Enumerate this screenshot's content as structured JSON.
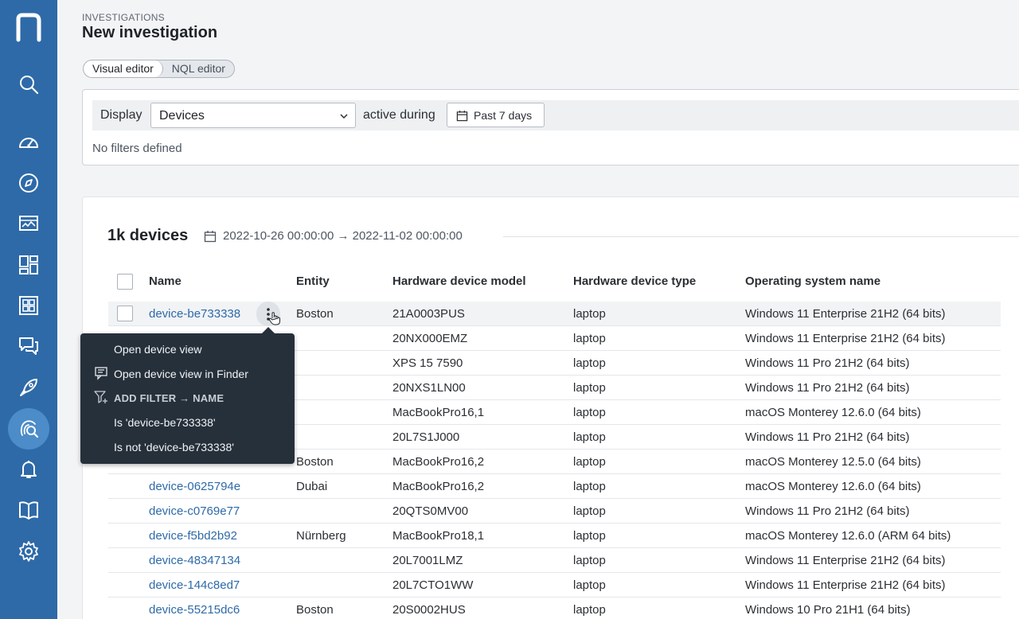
{
  "header": {
    "breadcrumb": "INVESTIGATIONS",
    "title": "New investigation"
  },
  "editor_toggle": {
    "visual": "Visual editor",
    "nql": "NQL editor",
    "active": "visual"
  },
  "builder": {
    "display_label": "Display",
    "display_value": "Devices",
    "during_label": "active during",
    "period": "Past 7 days",
    "no_filters": "No filters defined"
  },
  "results": {
    "count": "1k devices",
    "range": "2022-10-26 00:00:00 → 2022-11-02 00:00:00",
    "columns": [
      "Name",
      "Entity",
      "Hardware device model",
      "Hardware device type",
      "Operating system name"
    ],
    "rows": [
      {
        "name": "device-be733338",
        "entity": "Boston",
        "model": "21A0003PUS",
        "type": "laptop",
        "os": "Windows 11 Enterprise 21H2 (64 bits)"
      },
      {
        "name": "",
        "entity": "",
        "model": "20NX000EMZ",
        "type": "laptop",
        "os": "Windows 11 Enterprise 21H2 (64 bits)"
      },
      {
        "name": "",
        "entity": "",
        "model": "XPS 15 7590",
        "type": "laptop",
        "os": "Windows 11 Pro 21H2 (64 bits)"
      },
      {
        "name": "",
        "entity": "",
        "model": "20NXS1LN00",
        "type": "laptop",
        "os": "Windows 11 Pro 21H2 (64 bits)"
      },
      {
        "name": "",
        "entity": "",
        "model": "MacBookPro16,1",
        "type": "laptop",
        "os": "macOS Monterey 12.6.0 (64 bits)"
      },
      {
        "name": "",
        "entity": "",
        "model": "20L7S1J000",
        "type": "laptop",
        "os": "Windows 11 Pro 21H2 (64 bits)"
      },
      {
        "name": "",
        "entity": "Boston",
        "model": "MacBookPro16,2",
        "type": "laptop",
        "os": "macOS Monterey 12.5.0 (64 bits)"
      },
      {
        "name": "device-0625794e",
        "entity": "Dubai",
        "model": "MacBookPro16,2",
        "type": "laptop",
        "os": "macOS Monterey 12.6.0 (64 bits)"
      },
      {
        "name": "device-c0769e77",
        "entity": "",
        "model": "20QTS0MV00",
        "type": "laptop",
        "os": "Windows 11 Pro 21H2 (64 bits)"
      },
      {
        "name": "device-f5bd2b92",
        "entity": "Nürnberg",
        "model": "MacBookPro18,1",
        "type": "laptop",
        "os": "macOS Monterey 12.6.0 (ARM 64 bits)"
      },
      {
        "name": "device-48347134",
        "entity": "",
        "model": "20L7001LMZ",
        "type": "laptop",
        "os": "Windows 11 Enterprise 21H2 (64 bits)"
      },
      {
        "name": "device-144c8ed7",
        "entity": "",
        "model": "20L7CTO1WW",
        "type": "laptop",
        "os": "Windows 11 Enterprise 21H2 (64 bits)"
      },
      {
        "name": "device-55215dc6",
        "entity": "Boston",
        "model": "20S0002HUS",
        "type": "laptop",
        "os": "Windows 10 Pro 21H1 (64 bits)"
      }
    ]
  },
  "context_menu": {
    "open_view": "Open device view",
    "open_finder": "Open device view in Finder",
    "add_filter": "ADD FILTER → NAME",
    "is": "Is 'device-be733338'",
    "is_not": "Is not 'device-be733338'"
  },
  "sidebar": {
    "items": [
      "search-icon",
      "dashboard-gauge-icon",
      "compass-icon",
      "monitor-chart-icon",
      "layout-icon",
      "grid-icon",
      "chat-icon",
      "rocket-icon",
      "investigation-icon",
      "bell-icon",
      "book-icon",
      "gear-icon"
    ],
    "active": "investigation-icon"
  },
  "colors": {
    "sidebar": "#2e6aa8",
    "link": "#2e6aa8",
    "menu_bg": "#26303b"
  }
}
